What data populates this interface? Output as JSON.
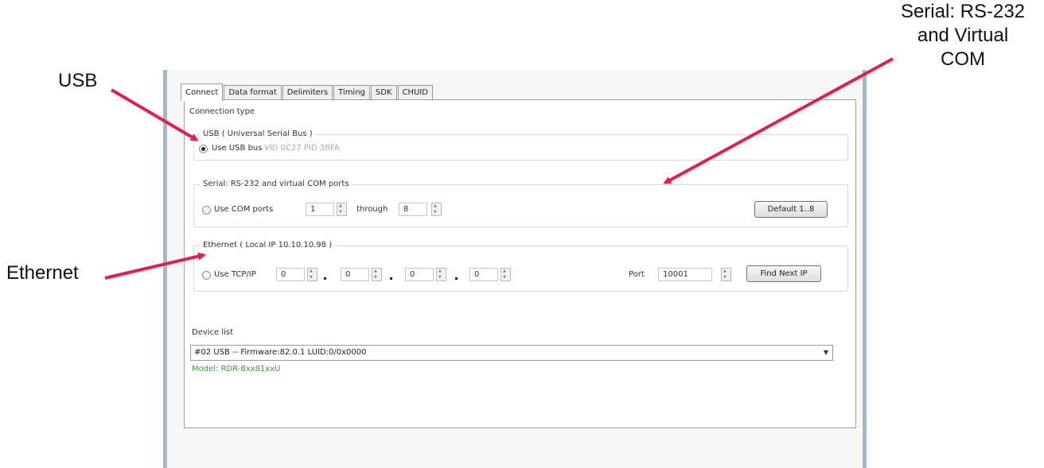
{
  "annotations": {
    "usb": "USB",
    "ethernet": "Ethernet",
    "serial": [
      "Serial: RS-232",
      "and Virtual",
      "COM"
    ],
    "arrow_color": "#e0204e"
  },
  "tabs": [
    "Connect",
    "Data format",
    "Delimiters",
    "Timing",
    "SDK",
    "CHUID"
  ],
  "active_tab": "Connect",
  "connection_type_label": "Connection type",
  "usb_group": {
    "legend": "USB ( Universal Serial Bus )",
    "option_label": "Use USB bus",
    "selected": true,
    "vid_pid": "VID 0C27 PID 3BFA"
  },
  "serial_group": {
    "legend": "Serial: RS-232 and virtual COM ports",
    "option_label": "Use COM ports",
    "from_port": "1",
    "through_label": "through",
    "to_port": "8",
    "default_button": "Default 1..8"
  },
  "ethernet_group": {
    "legend": "Ethernet ( Local IP 10.10.10.98 )",
    "option_label": "Use TCP/IP",
    "ip": [
      "0",
      "0",
      "0",
      "0"
    ],
    "port_label": "Port",
    "port_value": "10001",
    "find_next_button": "Find Next IP"
  },
  "device_list": {
    "label": "Device list",
    "selected": "#02 USB -- Firmware:82.0.1 LUID:0/0x0000",
    "model": "Model: RDR-8xx81xxU",
    "model_color": "#3a9a3a"
  }
}
